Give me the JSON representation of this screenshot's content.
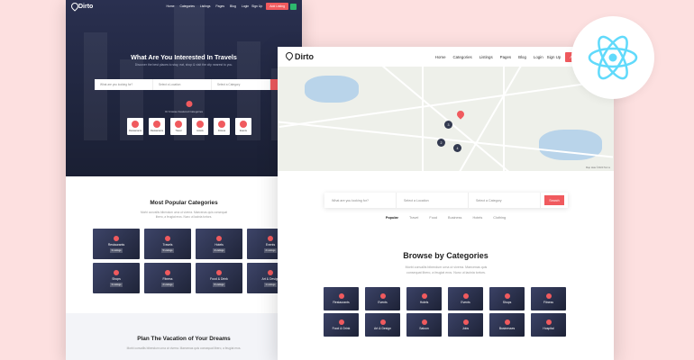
{
  "back": {
    "logo": "Dirto",
    "nav": [
      "Home",
      "Categories",
      "Listings",
      "Pages",
      "Blog"
    ],
    "login": "Login",
    "signup": "Sign Up",
    "add_listing": "Add Listing",
    "hero_title": "What Are You Interested In Travels",
    "hero_subtitle": "Discover the best places to stay, eat, shop & visit the city nearest to you.",
    "search_fields": [
      "What are you looking for?",
      "Select a Location",
      "Select a Category"
    ],
    "or_text": "Or browse Featured Categories",
    "hero_categories": [
      "Restaurants",
      "Restaurants",
      "Travel",
      "Hotels",
      "Fitness",
      "Events"
    ],
    "popular_title": "Most Popular Categories",
    "popular_subtitle": "Morbi convallis bibendum urna ut viverra. Maecenas quis consequat libero, a feugiat eros. Nunc ut lacinia tortors.",
    "popular_tiles": [
      {
        "label": "Restaurants",
        "badge": "3 Listings"
      },
      {
        "label": "Travels",
        "badge": "5 Listings"
      },
      {
        "label": "Hotels",
        "badge": "4 Listings"
      },
      {
        "label": "Events",
        "badge": "2 Listings"
      },
      {
        "label": "Shops",
        "badge": "3 Listings"
      },
      {
        "label": "Fitness",
        "badge": "2 Listings"
      },
      {
        "label": "Food & Drink",
        "badge": "6 Listings"
      },
      {
        "label": "Art & Design",
        "badge": "1 Listings"
      }
    ],
    "plan_title": "Plan The Vacation of Your Dreams",
    "plan_subtitle": "Morbi convallis bibendum urna ut viverra. Maecenas quis consequat libero, a feugiat eros."
  },
  "front": {
    "logo": "Dirto",
    "nav": [
      "Home",
      "Categories",
      "Listings",
      "Pages",
      "Blog"
    ],
    "login": "Login",
    "signup": "Sign Up",
    "add_listing": "Add Listing",
    "map_clusters": [
      "2",
      "3",
      "4"
    ],
    "map_footer": "Map data ©2020 Terms",
    "search_fields": [
      "What are you looking for?",
      "Select a Location",
      "Select a Category"
    ],
    "search_button": "Search",
    "tabs": [
      "Popular",
      "Travel",
      "Food",
      "Business",
      "Hotels",
      "Clothing"
    ],
    "browse_title": "Browse by Categories",
    "browse_subtitle": "Morbi convallis bibendum urna ut viverra. Maecenas quis consequat libero, a feugiat eros. Nunc ut lacinia tortors.",
    "categories": [
      "Restaurants",
      "Events",
      "Hotels",
      "Events",
      "Shops",
      "Fitness",
      "Food & Drink",
      "Art & Design",
      "Saloon",
      "Jobs",
      "Businesses",
      "Hospital"
    ]
  },
  "colors": {
    "accent": "#f05a5e",
    "green": "#2db86d",
    "react": "#61dafb"
  }
}
